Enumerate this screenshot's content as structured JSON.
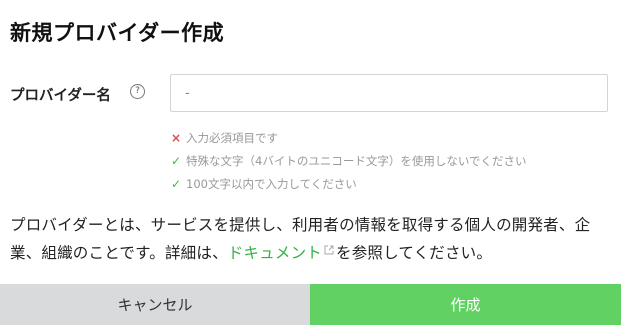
{
  "dialog": {
    "title": "新規プロバイダー作成"
  },
  "form": {
    "provider_name_label": "プロバイダー名",
    "help_icon": "?",
    "provider_name_value": "-",
    "rules": [
      {
        "status": "error",
        "icon": "×",
        "text": "入力必須項目です"
      },
      {
        "status": "ok",
        "icon": "✓",
        "text": "特殊な文字（4バイトのユニコード文字）を使用しないでください"
      },
      {
        "status": "ok",
        "icon": "✓",
        "text": "100文字以内で入力してください"
      }
    ]
  },
  "description": {
    "text_before_link": "プロバイダーとは、サービスを提供し、利用者の情報を取得する個人の開発者、企業、組織のことです。詳細は、",
    "link_text": "ドキュメント",
    "text_after_link": "を参照してください。"
  },
  "footer": {
    "cancel_label": "キャンセル",
    "create_label": "作成"
  },
  "colors": {
    "accent": "#62d164",
    "link": "#2fb344",
    "error": "#e0464a",
    "ok": "#3dbb44",
    "cancel_bg": "#d8dadc"
  },
  "icons": {
    "help": "help-circle-icon",
    "error": "cross-icon",
    "ok": "check-icon",
    "external": "external-link-icon"
  }
}
